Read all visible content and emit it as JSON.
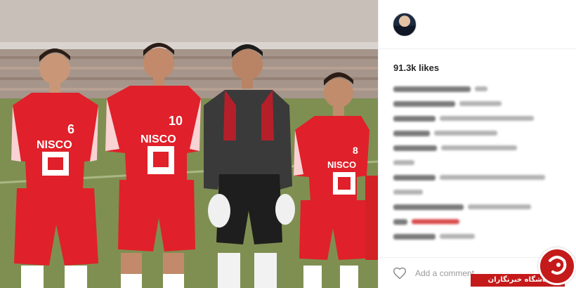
{
  "post": {
    "likes": "91.3k likes",
    "comment_placeholder": "Add a comment...",
    "watermark_text": "باشگاه خبرنگاران"
  },
  "photo": {
    "jerseys": [
      {
        "sponsor": "NISCO",
        "number": "6"
      },
      {
        "sponsor": "NISCO",
        "number": "10"
      },
      {
        "sponsor": "NISCO",
        "number": "8"
      }
    ]
  },
  "colors": {
    "jersey_red": "#e0202a",
    "watermark_red": "#c51a1a",
    "keeper_grey": "#3a3a3a"
  }
}
